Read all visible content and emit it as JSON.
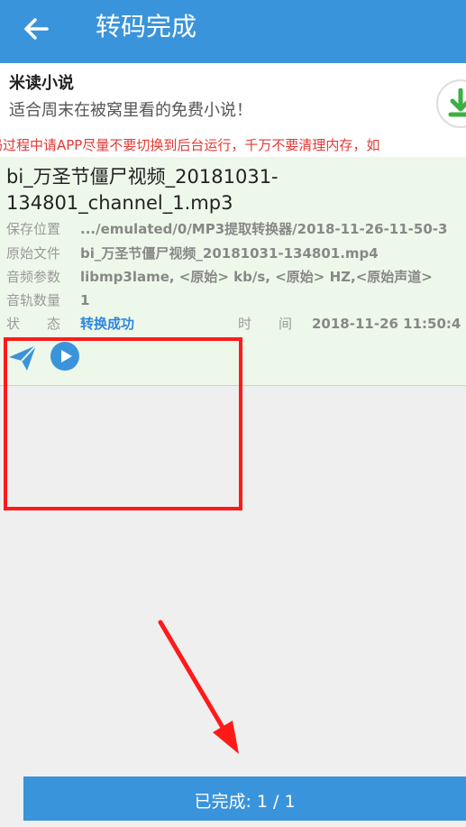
{
  "header": {
    "title": "转码完成"
  },
  "ad": {
    "name": "米读小说",
    "description": "适合周末在被窝里看的免费小说！"
  },
  "warning": "码过程中请APP尽量不要切换到后台运行，千万不要清理内存，如",
  "item": {
    "title": "bi_万圣节僵尸视频_20181031-134801_channel_1.mp3",
    "save_location_label": "保存位置",
    "save_location_value": ".../emulated/0/MP3提取转换器/2018-11-26-11-50-3",
    "source_file_label": "原始文件",
    "source_file_value": "bi_万圣节僵尸视频_20181031-134801.mp4",
    "audio_params_label": "音频参数",
    "audio_params_value": "libmp3lame, <原始> kb/s, <原始> HZ,<原始声道>",
    "track_count_label": "音轨数量",
    "track_count_value": "1",
    "status_label": "状　　态",
    "status_value": "转换成功",
    "time_label": "时　　间",
    "time_value": "2018-11-26 11:50:4"
  },
  "footer": {
    "done_label": "已完成: 1 / 1"
  },
  "colors": {
    "primary": "#3a94db",
    "warning": "#e53935",
    "card_bg": "#eef8ea",
    "highlight": "#ff1a1a",
    "success": "#2e86de"
  },
  "icons": [
    "back-arrow-icon",
    "download-icon",
    "send-icon",
    "play-icon"
  ]
}
